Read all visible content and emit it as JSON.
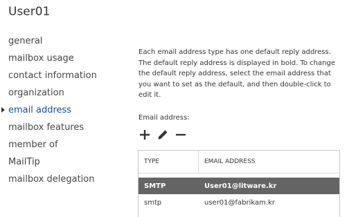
{
  "title": "User01",
  "nav": {
    "items": [
      {
        "label": "general"
      },
      {
        "label": "mailbox usage"
      },
      {
        "label": "contact information"
      },
      {
        "label": "organization"
      },
      {
        "label": "email address",
        "active": true
      },
      {
        "label": "mailbox features"
      },
      {
        "label": "member of"
      },
      {
        "label": "MailTip"
      },
      {
        "label": "mailbox delegation"
      }
    ]
  },
  "main": {
    "description": "Each email address type has one default reply address. The default reply address is displayed in bold. To change the default reply address, select the email address that you want to set as the default, and then double-click to edit it.",
    "email_label": "Email address:",
    "toolbar": {
      "add_icon": "plus-icon",
      "edit_icon": "pencil-icon",
      "remove_icon": "minus-icon"
    },
    "table": {
      "headers": {
        "type": "TYPE",
        "address": "EMAIL ADDRESS"
      },
      "rows": [
        {
          "type": "SMTP",
          "address": "User01@litware.kr",
          "selected": true
        },
        {
          "type": "smtp",
          "address": "user01@fabrikam.kr"
        }
      ]
    }
  },
  "colors": {
    "accent": "#0f4f9e",
    "selected_row": "#646464",
    "text": "#333333"
  }
}
